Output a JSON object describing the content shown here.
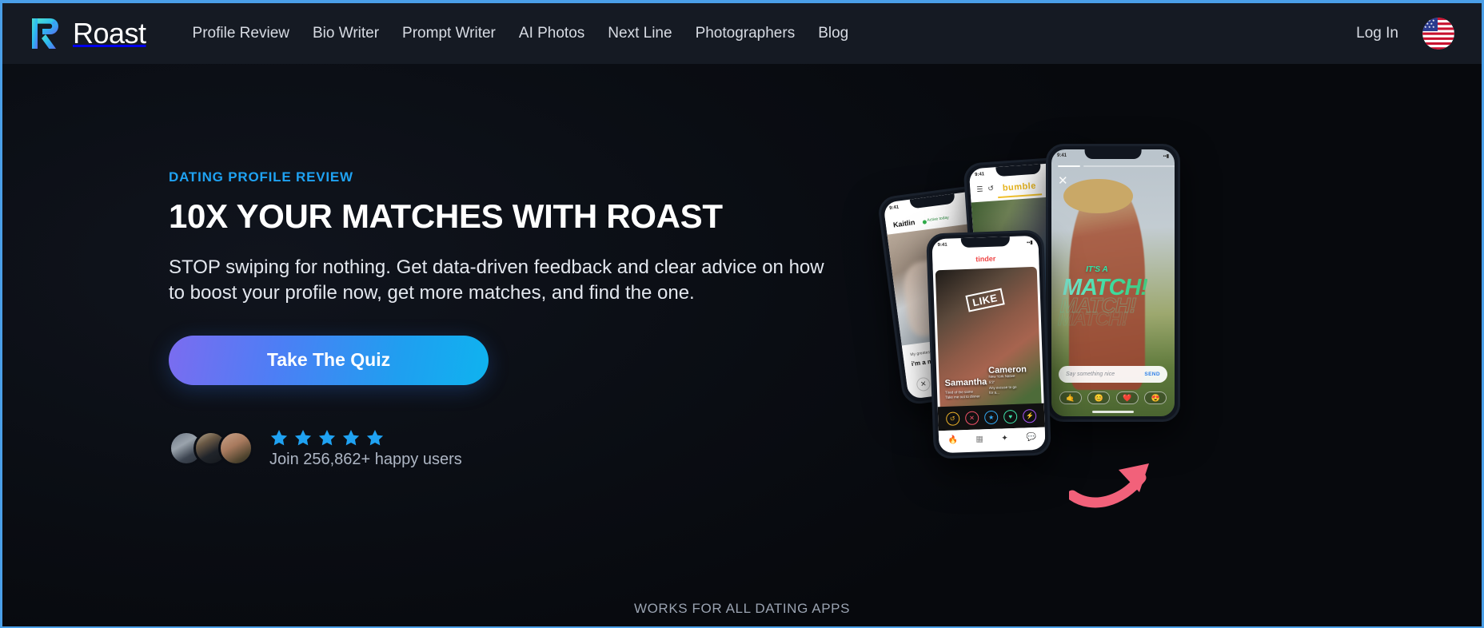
{
  "brand": {
    "name": "Roast",
    "logo_icon": "roast-r-logo-icon"
  },
  "nav": {
    "links": [
      {
        "label": "Profile Review"
      },
      {
        "label": "Bio Writer"
      },
      {
        "label": "Prompt Writer"
      },
      {
        "label": "AI Photos"
      },
      {
        "label": "Next Line"
      },
      {
        "label": "Photographers"
      },
      {
        "label": "Blog"
      }
    ],
    "login_label": "Log In",
    "locale_icon": "us-flag-icon"
  },
  "hero": {
    "eyebrow": "DATING PROFILE REVIEW",
    "headline": "10X YOUR MATCHES WITH ROAST",
    "subcopy": "STOP swiping for nothing. Get data-driven feedback and clear advice on how to boost your profile now, get more matches, and find the one.",
    "cta_label": "Take The Quiz",
    "social_proof": {
      "star_count": 5,
      "join_text": "Join 256,862+ happy users",
      "avatar_count": 3
    }
  },
  "mockups": {
    "phone_hinge": {
      "name": "Kaitlin",
      "status": "Active today",
      "bio_label": "My greatest strength",
      "bio_answer": "i'm a morning person"
    },
    "phone_bumble": {
      "logo": "bumble",
      "verified_icon": "check-badge-icon"
    },
    "phone_tinder": {
      "logo": "tinder",
      "stamp": "LIKE",
      "profile_one_name": "Samantha",
      "profile_one_line_a": "Tired of the same",
      "profile_one_line_b": "Take me out to dinner",
      "profile_two_name": "Cameron",
      "profile_two_line_a": "New York Native",
      "profile_two_line_b": "5'3\"",
      "profile_two_line_c": "Any excuse to go",
      "profile_two_line_d": "for a...",
      "actions": [
        "rewind-icon",
        "nope-icon",
        "superlike-icon",
        "like-icon",
        "boost-icon"
      ],
      "tabs": [
        "flame-icon",
        "explore-icon",
        "sparkle-icon",
        "chat-icon"
      ]
    },
    "phone_match": {
      "status_time": "9:41",
      "its_label": "IT'S A",
      "match_label": "MATCH!",
      "input_placeholder": "Say something nice",
      "send_label": "SEND",
      "reactions": [
        "🤙",
        "😊",
        "❤️",
        "😍"
      ],
      "close_icon": "close-icon"
    },
    "arrow_icon": "curved-arrow-icon",
    "arrow_color": "#f2617a"
  },
  "footer": {
    "note": "WORKS FOR ALL DATING APPS"
  },
  "colors": {
    "accent_blue": "#1fa2f2",
    "background": "#0b0e15",
    "nav_background": "#151a23",
    "cta_gradient_start": "#7b6cf0",
    "cta_gradient_end": "#0fb3ef",
    "bumble_yellow": "#e7b41d",
    "tinder_red": "#ef4444",
    "match_green": "#3ddca0"
  }
}
